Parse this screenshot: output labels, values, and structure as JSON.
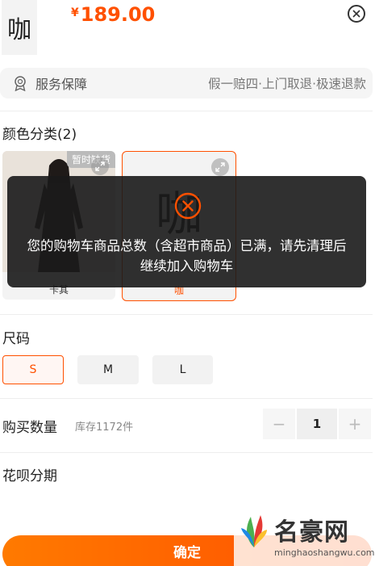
{
  "product": {
    "thumb_char": "咖",
    "currency_symbol": "¥",
    "price": "189.00"
  },
  "service": {
    "title": "服务保障",
    "desc": "假一赔四·上门取退·极速退款"
  },
  "color_section": {
    "title": "颜色分类(2)",
    "options": [
      {
        "label": "卡其",
        "badge": "暂时缺货"
      },
      {
        "label": "咖",
        "display_char": "咖"
      }
    ]
  },
  "toast": {
    "message": "您的购物车商品总数（含超市商品）已满，请先清理后继续加入购物车"
  },
  "size_section": {
    "title": "尺码",
    "options": [
      "S",
      "M",
      "L"
    ],
    "selected": "S"
  },
  "quantity": {
    "label": "购买数量",
    "stock": "库存1172件",
    "value": "1",
    "minus": "−",
    "plus": "+"
  },
  "installment": {
    "title": "花呗分期"
  },
  "confirm": {
    "label": "确定"
  },
  "watermark": {
    "title": "名豪网",
    "url": "minghaoshangwu.com"
  },
  "colors": {
    "accent": "#ff5000",
    "toast_bg": "#191919",
    "error_icon": "#ff5000"
  }
}
